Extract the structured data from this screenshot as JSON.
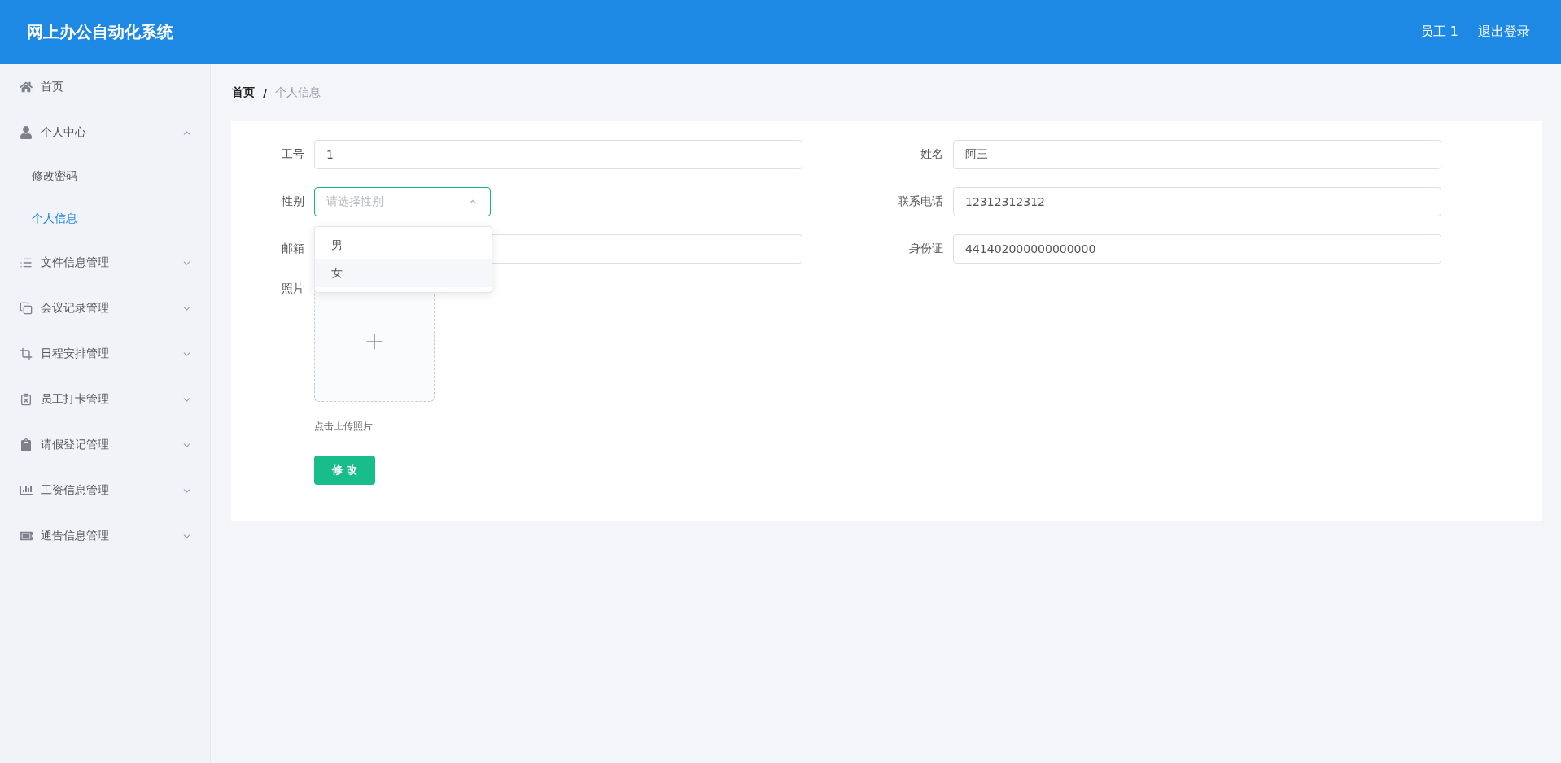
{
  "header": {
    "title": "网上办公自动化系统",
    "user": "员工 1",
    "logout": "退出登录"
  },
  "sidebar": {
    "items": [
      {
        "label": "首页"
      },
      {
        "label": "个人中心",
        "expanded": true,
        "children": [
          {
            "label": "修改密码",
            "selected": false
          },
          {
            "label": "个人信息",
            "selected": true
          }
        ]
      },
      {
        "label": "文件信息管理",
        "expanded": false
      },
      {
        "label": "会议记录管理",
        "expanded": false
      },
      {
        "label": "日程安排管理",
        "expanded": false
      },
      {
        "label": "员工打卡管理",
        "expanded": false
      },
      {
        "label": "请假登记管理",
        "expanded": false
      },
      {
        "label": "工资信息管理",
        "expanded": false
      },
      {
        "label": "通告信息管理",
        "expanded": false
      }
    ]
  },
  "breadcrumb": [
    {
      "label": "首页"
    },
    {
      "label": "个人信息"
    }
  ],
  "breadcrumb_separator": "/",
  "form": {
    "left": [
      {
        "label": "工号",
        "value": "1"
      },
      {
        "label": "性别",
        "placeholder": "请选择性别",
        "open": true,
        "options": [
          {
            "label": "男",
            "hovered": false
          },
          {
            "label": "女",
            "hovered": true
          }
        ]
      },
      {
        "label": "邮箱"
      }
    ],
    "right": [
      {
        "label": "姓名",
        "value": "阿三"
      },
      {
        "label": "联系电话",
        "value": "12312312312"
      },
      {
        "label": "身份证",
        "value": "441402000000000000"
      }
    ],
    "photo": {
      "label": "照片",
      "hint": "点击上传照片"
    },
    "submit": "修 改"
  }
}
